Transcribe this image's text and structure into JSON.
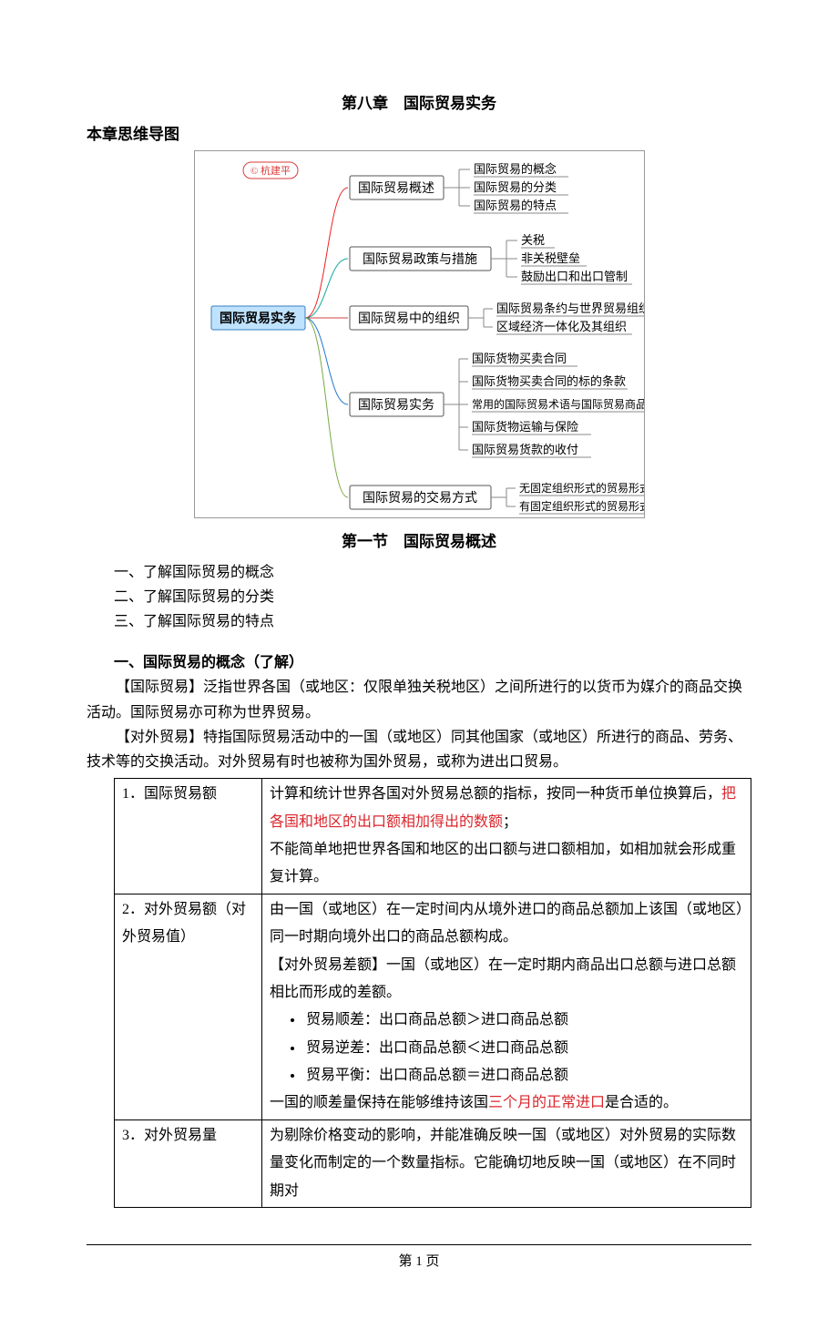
{
  "chapter_title": "第八章　国际贸易实务",
  "mindmap_label": "本章思维导图",
  "mindmap": {
    "copyright": "© 杭建平",
    "root": "国际贸易实务",
    "branches": [
      {
        "title": "国际贸易概述",
        "children": [
          "国际贸易的概念",
          "国际贸易的分类",
          "国际贸易的特点"
        ]
      },
      {
        "title": "国际贸易政策与措施",
        "children": [
          "关税",
          "非关税壁垒",
          "鼓励出口和出口管制"
        ]
      },
      {
        "title": "国际贸易中的组织",
        "children": [
          "国际贸易条约与世界贸易组织",
          "区域经济一体化及其组织"
        ]
      },
      {
        "title": "国际贸易实务",
        "children": [
          "国际货物买卖合同",
          "国际货物买卖合同的标的条款",
          "常用的国际贸易术语与国际贸易商品价格",
          "国际货物运输与保险",
          "国际贸易货款的收付"
        ]
      },
      {
        "title": "国际贸易的交易方式",
        "children": [
          "无固定组织形式的贸易形式",
          "有固定组织形式的贸易形式"
        ]
      }
    ]
  },
  "section_title": "第一节　国际贸易概述",
  "key_points": [
    "一、了解国际贸易的概念",
    "二、了解国际贸易的分类",
    "三、了解国际贸易的特点"
  ],
  "heading_1": "一、国际贸易的概念（了解）",
  "para_1a": "【国际贸易】泛指世界各国（或地区：仅限单独关税地区）之间所进行的以货币为媒介的商品交换活动。国际贸易亦可称为世界贸易。",
  "para_1b": "【对外贸易】特指国际贸易活动中的一国（或地区）同其他国家（或地区）所进行的商品、劳务、技术等的交换活动。对外贸易有时也被称为国外贸易，或称为进出口贸易。",
  "table": {
    "rows": [
      {
        "term": "1．国际贸易额",
        "def_plain1": "计算和统计世界各国对外贸易总额的指标，按同一种货币单位换算后，",
        "def_red1": "把各国和地区的出口额相加得出的数额",
        "def_plain1b": "；",
        "def_plain2": "不能简单地把世界各国和地区的出口额与进口额相加，如相加就会形成重复计算。"
      },
      {
        "term": "2．对外贸易额（对外贸易值）",
        "def_plain1": "由一国（或地区）在一定时间内从境外进口的商品总额加上该国（或地区）同一时期向境外出口的商品总额构成。",
        "def_plain2": "【对外贸易差额】一国（或地区）在一定时期内商品出口总额与进口总额相比而形成的差额。",
        "bullets": [
          "贸易顺差：出口商品总额＞进口商品总额",
          "贸易逆差：出口商品总额＜进口商品总额",
          "贸易平衡：出口商品总额＝进口商品总额"
        ],
        "def_plain3_a": "一国的顺差量保持在能够维持该国",
        "def_red3": "三个月的正常进口",
        "def_plain3_b": "是合适的。"
      },
      {
        "term": "3．对外贸易量",
        "def_plain1": "为剔除价格变动的影响，并能准确反映一国（或地区）对外贸易的实际数量变化而制定的一个数量指标。它能确切地反映一国（或地区）在不同时期对"
      }
    ]
  },
  "footer": "第 1 页"
}
